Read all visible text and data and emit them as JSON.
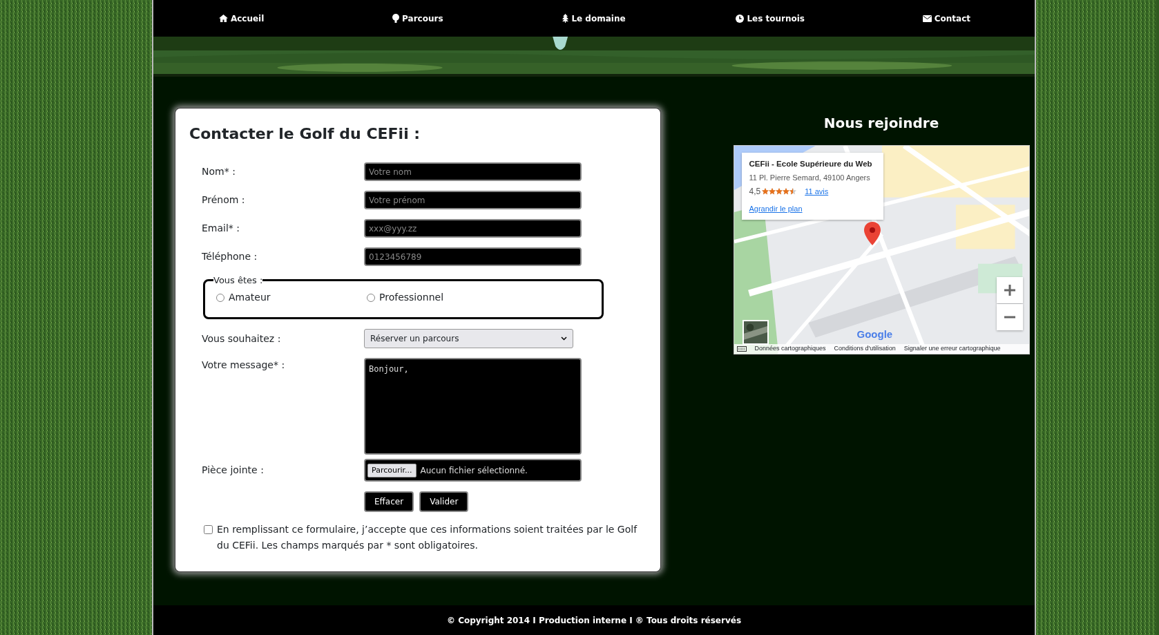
{
  "nav": [
    {
      "label": "Accueil"
    },
    {
      "label": "Parcours"
    },
    {
      "label": "Le domaine"
    },
    {
      "label": "Les tournois"
    },
    {
      "label": "Contact"
    }
  ],
  "form": {
    "title": "Contacter le Golf du CEFii :",
    "fields": [
      {
        "label": "Nom* :",
        "placeholder": "Votre nom"
      },
      {
        "label": "Prénom :",
        "placeholder": "Votre prénom"
      },
      {
        "label": "Email* :",
        "placeholder": "xxx@yyy.zz"
      },
      {
        "label": "Téléphone :",
        "placeholder": "0123456789"
      }
    ],
    "radio_group": {
      "legend": "Vous êtes :",
      "options": [
        {
          "label": "Amateur",
          "selected": false
        },
        {
          "label": "Professionnel",
          "selected": false
        }
      ]
    },
    "wish": {
      "label": "Vous souhaitez :",
      "value": "Réserver un parcours"
    },
    "message": {
      "label": "Votre message* :",
      "value": "Bonjour,"
    },
    "attachment": {
      "label": "Pièce jointe :",
      "button": "Parcourir...",
      "status": "Aucun fichier sélectionné."
    },
    "buttons": [
      "Effacer",
      "Valider"
    ],
    "consent": {
      "checked": false,
      "text": "En remplissant ce formulaire, j’accepte que ces informations soient traitées par le Golf du CEFii. Les champs marqués par * sont obligatoires."
    }
  },
  "map": {
    "title": "Nous rejoindre",
    "place_name": "CEFii - Ecole Supérieure du Web",
    "address": "11 Pl. Pierre Semard, 49100 Angers",
    "rating": "4,5",
    "stars": 4.5,
    "reviews": "11 avis",
    "enlarge_link": "Agrandir le plan",
    "logo": "Google",
    "attribution": [
      "Données cartographiques",
      "Conditions d'utilisation",
      "Signaler une erreur cartographique"
    ]
  },
  "footer": "© Copyright 2014 I Production interne I ® Tous droits réservés"
}
